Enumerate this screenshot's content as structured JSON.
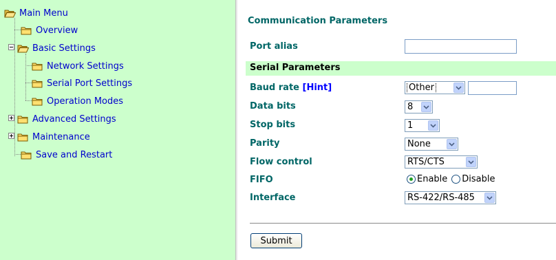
{
  "tree": {
    "root": "Main Menu",
    "items": [
      {
        "label": "Overview"
      },
      {
        "label": "Basic Settings"
      },
      {
        "label": "Network Settings"
      },
      {
        "label": "Serial Port Settings"
      },
      {
        "label": "Operation Modes"
      },
      {
        "label": "Advanced Settings"
      },
      {
        "label": "Maintenance"
      },
      {
        "label": "Save and Restart"
      }
    ]
  },
  "form": {
    "title": "Communication Parameters",
    "port_alias": {
      "label": "Port alias",
      "value": ""
    },
    "section": "Serial Parameters",
    "baud_rate": {
      "label": "Baud rate",
      "hint": "[Hint]",
      "value": "Other",
      "custom": ""
    },
    "data_bits": {
      "label": "Data bits",
      "value": "8"
    },
    "stop_bits": {
      "label": "Stop bits",
      "value": "1"
    },
    "parity": {
      "label": "Parity",
      "value": "None"
    },
    "flow_control": {
      "label": "Flow control",
      "value": "RTS/CTS"
    },
    "fifo": {
      "label": "FIFO",
      "options": [
        "Enable",
        "Disable"
      ],
      "selected": "Enable"
    },
    "interface": {
      "label": "Interface",
      "value": "RS-422/RS-485"
    },
    "submit": "Submit"
  }
}
